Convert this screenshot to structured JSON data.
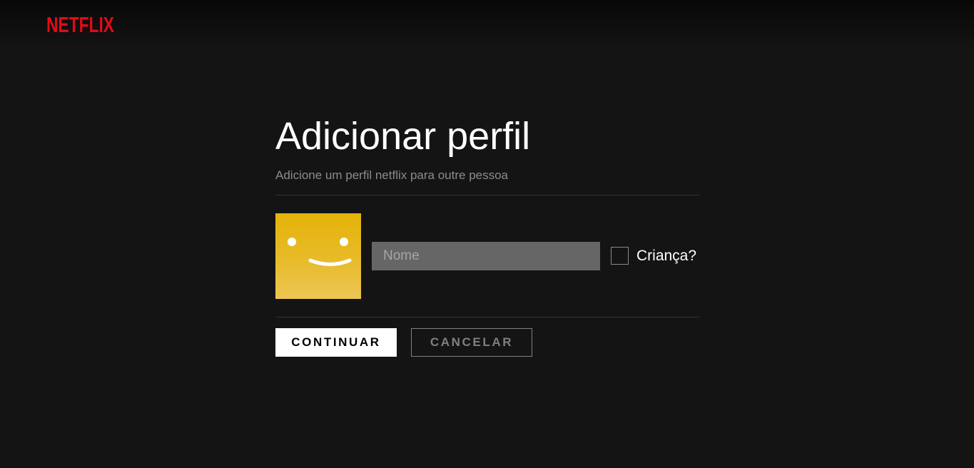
{
  "brand": {
    "logo_text": "NETFLIX",
    "logo_color": "#e50914"
  },
  "page": {
    "title": "Adicionar perfil",
    "subtitle": "Adicione um perfil netflix para outre pessoa"
  },
  "profile": {
    "avatar_icon": "smiley-avatar-icon",
    "avatar_color": "#e6b30a",
    "name_placeholder": "Nome",
    "name_value": "",
    "kids_label": "Criança?",
    "kids_checked": false
  },
  "actions": {
    "continue_label": "CONTINUAR",
    "cancel_label": "CANCELAR"
  }
}
